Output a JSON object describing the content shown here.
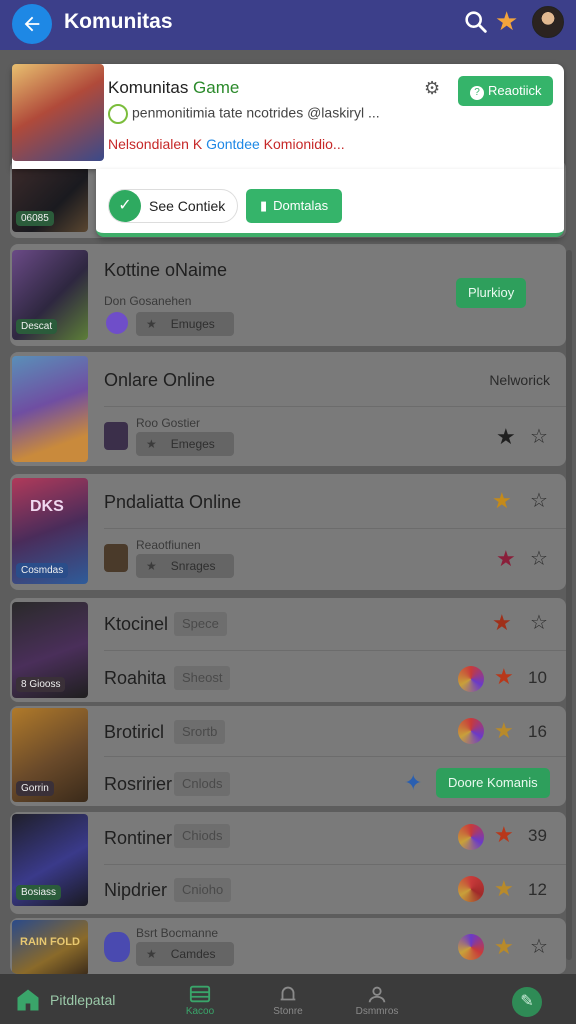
{
  "topbar": {
    "title": "Komunitas",
    "back_icon": "arrow-left-icon",
    "search_icon": "search-icon",
    "star_icon": "star-icon",
    "avatar_icon": "avatar"
  },
  "popup": {
    "title_prefix": "Komunitas ",
    "title_game": "Game",
    "description": "penmonitimia tate ncotrides @laskiryl ...",
    "warning_red": "Nelsondialen K",
    "warning_blue": "Gontdee",
    "warning_red2": "Komionidio...",
    "action_button": "Reaotiick",
    "see_button": "See Contiek",
    "download_button": "Domtalas",
    "gear_icon": "gear-icon"
  },
  "cards": [
    {
      "thumb_badge": "06085",
      "title": "",
      "sub": ""
    },
    {
      "thumb_badge": "Descat",
      "title": "Kottine oNaime",
      "sub": "Don Gosanehen",
      "pill": "Emuges",
      "button": "Plurkioy"
    },
    {
      "title": "Onlare Online",
      "status": "Nelworick",
      "sub": "Roo Gostier",
      "pill": "Emeges"
    },
    {
      "thumb_label": "DKS",
      "thumb_badge": "Cosmdas",
      "title": "Pndaliatta Online",
      "sub": "Reaotfiunen",
      "pill": "Snrages"
    },
    {
      "thumb_badge": "8 Giooss",
      "rows": [
        {
          "title": "Ktocinel",
          "tag": "Spece",
          "count": ""
        },
        {
          "title": "Roahita",
          "tag": "Sheost",
          "count": "10"
        }
      ]
    },
    {
      "thumb_badge": "Gorrin",
      "rows": [
        {
          "title": "Brotiricl",
          "tag": "Srortb",
          "count": "16"
        },
        {
          "title": "Rosririer",
          "tag": "Cnlods",
          "count": "",
          "button": "Doore Komanis"
        }
      ]
    },
    {
      "thumb_badge": "Bosiass",
      "rows": [
        {
          "title": "Rontiner",
          "tag": "Chiods",
          "count": "39"
        },
        {
          "title": "Nipdrier",
          "tag": "Cnioho",
          "count": "12"
        }
      ]
    },
    {
      "thumb_label": "RAIN FOLD",
      "sub": "Bsrt Bocmanne",
      "pill": "Camdes"
    }
  ],
  "bottom_nav": {
    "home": "Pitdlepatal",
    "tab2": "Kacoo",
    "tab3": "Stonre",
    "tab4": "Dsmmros"
  }
}
